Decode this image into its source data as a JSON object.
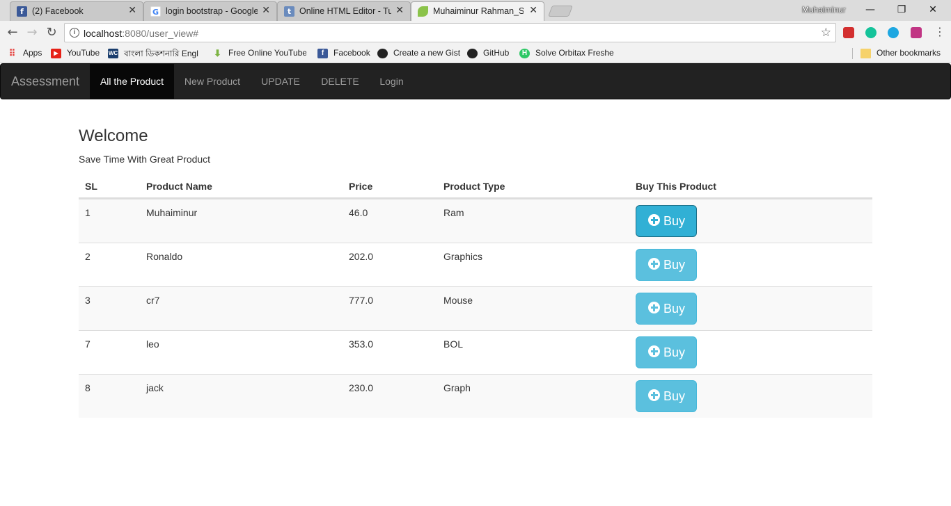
{
  "browser": {
    "tabs": [
      {
        "title": "(2) Facebook",
        "icon": "facebook-icon",
        "active": false
      },
      {
        "title": "login bootstrap - Google",
        "icon": "google-icon",
        "active": false
      },
      {
        "title": "Online HTML Editor - Tut",
        "icon": "tutorialspoint-icon",
        "active": false
      },
      {
        "title": "Muhaiminur Rahman_SE",
        "icon": "leaf-icon",
        "active": true
      }
    ],
    "profile_name": "Muhaiminur",
    "window_controls": {
      "minimize": "—",
      "restore": "❐",
      "close": "✕"
    },
    "nav": {
      "back": "←",
      "forward": "→",
      "reload": "↻"
    },
    "url_host": "localhost",
    "url_rest": ":8080/user_view#",
    "star": "☆",
    "menu": "⋮",
    "bookmarks": [
      {
        "label": "Apps",
        "icon": "apps-grid-icon"
      },
      {
        "label": "YouTube",
        "icon": "youtube-icon"
      },
      {
        "label": "বাংলা ডিকশনারি Engl",
        "icon": "dictionary-icon"
      },
      {
        "label": "Free Online YouTube",
        "icon": "download-arrow-icon"
      },
      {
        "label": "Facebook",
        "icon": "facebook-icon"
      },
      {
        "label": "Create a new Gist",
        "icon": "github-icon"
      },
      {
        "label": "GitHub",
        "icon": "github-icon"
      },
      {
        "label": "Solve Orbitax Fresher",
        "icon": "hackerrank-icon"
      }
    ],
    "other_bookmarks": "Other bookmarks"
  },
  "navbar": {
    "brand": "Assessment",
    "links": [
      {
        "label": "All the Product",
        "active": true
      },
      {
        "label": "New Product",
        "active": false
      },
      {
        "label": "UPDATE",
        "active": false
      },
      {
        "label": "DELETE",
        "active": false
      },
      {
        "label": "Login",
        "active": false
      }
    ]
  },
  "page": {
    "heading": "Welcome",
    "subheading": "Save Time With Great Product"
  },
  "table": {
    "columns": [
      "SL",
      "Product Name",
      "Price",
      "Product Type",
      "Buy This Product"
    ],
    "buy_label": "Buy",
    "rows": [
      {
        "sl": "1",
        "name": "Muhaiminur",
        "price": "46.0",
        "type": "Ram"
      },
      {
        "sl": "2",
        "name": "Ronaldo",
        "price": "202.0",
        "type": "Graphics"
      },
      {
        "sl": "3",
        "name": "cr7",
        "price": "777.0",
        "type": "Mouse"
      },
      {
        "sl": "7",
        "name": "leo",
        "price": "353.0",
        "type": "BOL"
      },
      {
        "sl": "8",
        "name": "jack",
        "price": "230.0",
        "type": "Graph"
      }
    ]
  },
  "colors": {
    "navbar_bg": "#222222",
    "button_info": "#5bc0de",
    "button_info_focus": "#31b0d5"
  }
}
